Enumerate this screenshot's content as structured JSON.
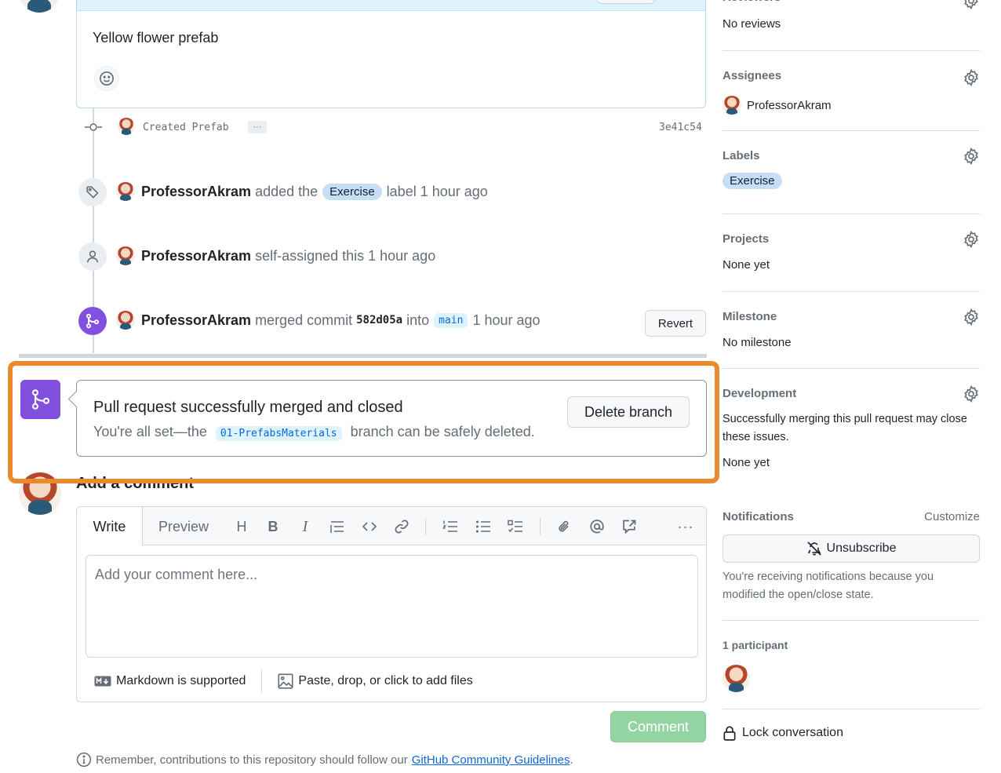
{
  "top_comment": {
    "body": "Yellow flower prefab"
  },
  "commit": {
    "message": "Created Prefab",
    "more": "···",
    "sha": "3e41c54"
  },
  "timeline": {
    "label_event": {
      "author": "ProfessorAkram",
      "action": "added the",
      "label": "Exercise",
      "suffix": "label 1 hour ago"
    },
    "assign_event": {
      "author": "ProfessorAkram",
      "action": "self-assigned this 1 hour ago"
    },
    "merge_event": {
      "author": "ProfessorAkram",
      "action": "merged commit",
      "sha": "582d05a",
      "into": "into",
      "branch": "main",
      "time": "1 hour ago",
      "revert_label": "Revert"
    }
  },
  "merge_status": {
    "title": "Pull request successfully merged and closed",
    "sub_prefix": "You're all set—the",
    "branch": "01-PrefabsMaterials",
    "sub_suffix": "branch can be safely deleted.",
    "delete_label": "Delete branch",
    "highlight_color": "#ea8a2f"
  },
  "add_comment": {
    "title": "Add a comment",
    "tabs": [
      "Write",
      "Preview"
    ],
    "placeholder": "Add your comment here...",
    "markdown_note": "Markdown is supported",
    "files_note": "Paste, drop, or click to add files",
    "submit_label": "Comment",
    "guideline_prefix": "Remember, contributions to this repository should follow our",
    "guideline_link": "GitHub Community Guidelines",
    "guideline_suffix": "."
  },
  "sidebar": {
    "reviewers": {
      "heading": "Reviewers",
      "value": "No reviews"
    },
    "assignees": {
      "heading": "Assignees",
      "value": "ProfessorAkram"
    },
    "labels": {
      "heading": "Labels",
      "value": "Exercise"
    },
    "projects": {
      "heading": "Projects",
      "value": "None yet"
    },
    "milestone": {
      "heading": "Milestone",
      "value": "No milestone"
    },
    "development": {
      "heading": "Development",
      "description": "Successfully merging this pull request may close these issues.",
      "value": "None yet"
    },
    "notifications": {
      "heading": "Notifications",
      "customize": "Customize",
      "unsubscribe": "Unsubscribe",
      "reason": "You're receiving notifications because you modified the open/close state."
    },
    "participants": {
      "heading": "1 participant"
    },
    "lock": "Lock conversation"
  }
}
